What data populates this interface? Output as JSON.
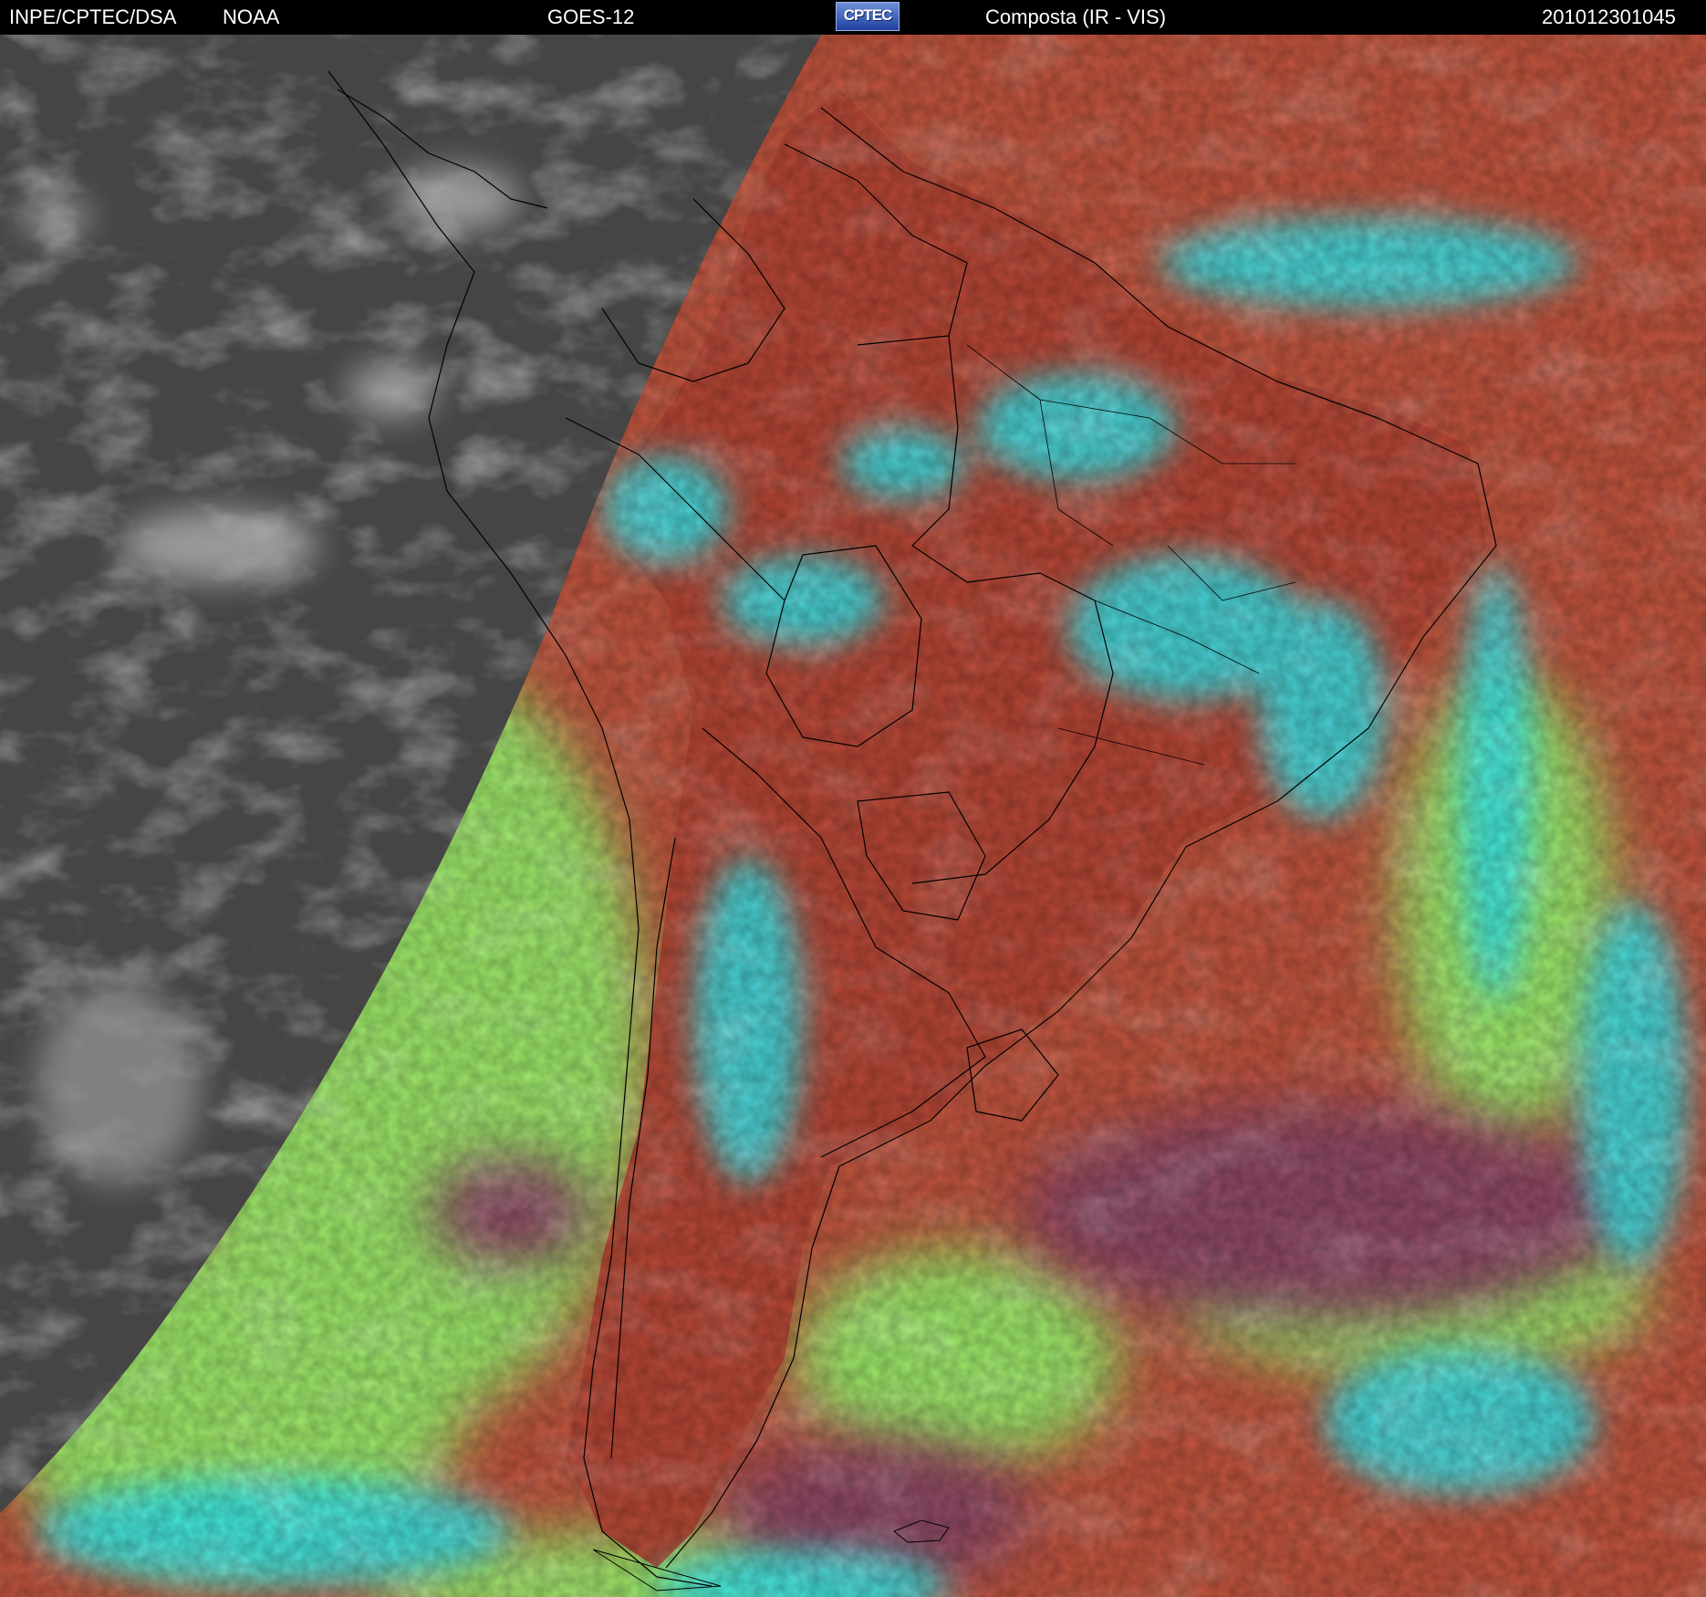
{
  "header": {
    "institution": "INPE/CPTEC/DSA",
    "agency": "NOAA",
    "satellite": "GOES-12",
    "logo_text": "CPTEC",
    "product": "Composta (IR - VIS)",
    "timestamp": "201012301045"
  },
  "map": {
    "region": "South America",
    "colors": {
      "night_ir": "#4a4a4a",
      "low_cloud": "#9ee86a",
      "high_cloud": "#34e9f0",
      "land_clear": "#b84a3a",
      "ocean_clear": "#c2553f",
      "ocean_cold": "#8f4a66",
      "boundaries": "#000000"
    }
  }
}
